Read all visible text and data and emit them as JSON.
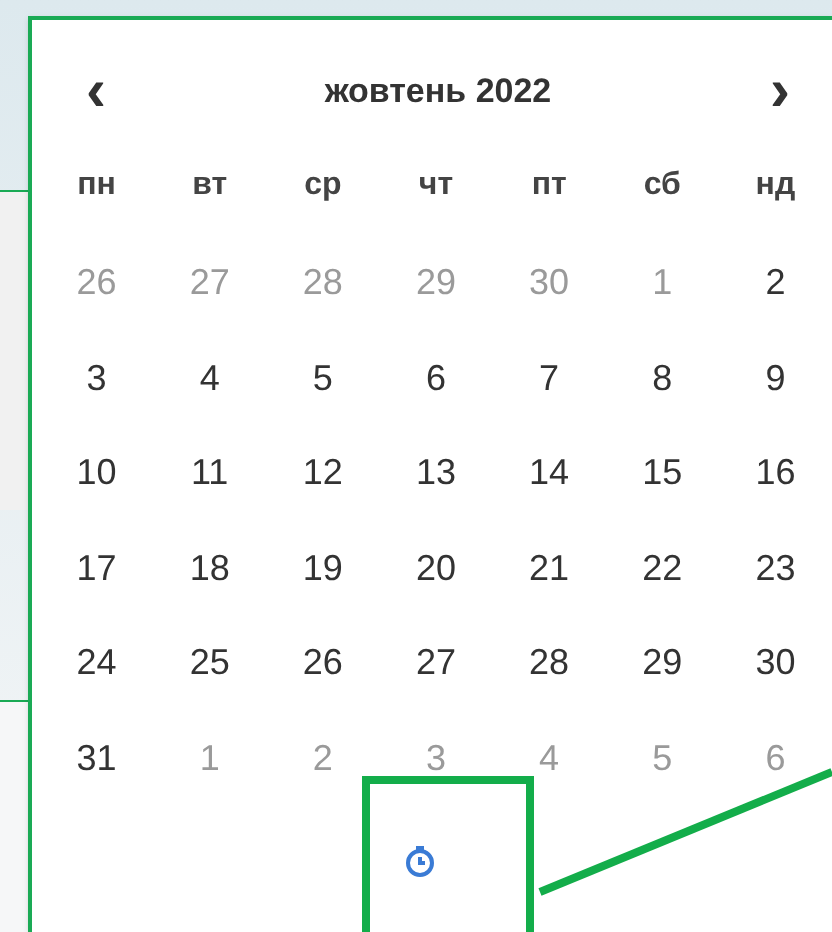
{
  "calendar": {
    "month_label": "жовтень 2022",
    "prev": "‹",
    "next": "›",
    "weekdays": [
      "пн",
      "вт",
      "ср",
      "чт",
      "пт",
      "сб",
      "нд"
    ],
    "weeks": [
      [
        {
          "day": "26",
          "dimmed": true
        },
        {
          "day": "27",
          "dimmed": true
        },
        {
          "day": "28",
          "dimmed": true
        },
        {
          "day": "29",
          "dimmed": true
        },
        {
          "day": "30",
          "dimmed": true
        },
        {
          "day": "1",
          "dimmed": true
        },
        {
          "day": "2",
          "dimmed": false
        }
      ],
      [
        {
          "day": "3",
          "dimmed": false
        },
        {
          "day": "4",
          "dimmed": false
        },
        {
          "day": "5",
          "dimmed": false
        },
        {
          "day": "6",
          "dimmed": false
        },
        {
          "day": "7",
          "dimmed": false
        },
        {
          "day": "8",
          "dimmed": false
        },
        {
          "day": "9",
          "dimmed": false
        }
      ],
      [
        {
          "day": "10",
          "dimmed": false
        },
        {
          "day": "11",
          "dimmed": false
        },
        {
          "day": "12",
          "dimmed": false
        },
        {
          "day": "13",
          "dimmed": false
        },
        {
          "day": "14",
          "dimmed": false
        },
        {
          "day": "15",
          "dimmed": false
        },
        {
          "day": "16",
          "dimmed": false
        }
      ],
      [
        {
          "day": "17",
          "dimmed": false
        },
        {
          "day": "18",
          "dimmed": false
        },
        {
          "day": "19",
          "dimmed": false
        },
        {
          "day": "20",
          "dimmed": false
        },
        {
          "day": "21",
          "dimmed": false
        },
        {
          "day": "22",
          "dimmed": false
        },
        {
          "day": "23",
          "dimmed": false
        }
      ],
      [
        {
          "day": "24",
          "dimmed": false
        },
        {
          "day": "25",
          "dimmed": false
        },
        {
          "day": "26",
          "dimmed": false
        },
        {
          "day": "27",
          "dimmed": false
        },
        {
          "day": "28",
          "dimmed": false
        },
        {
          "day": "29",
          "dimmed": false
        },
        {
          "day": "30",
          "dimmed": false
        }
      ],
      [
        {
          "day": "31",
          "dimmed": false
        },
        {
          "day": "1",
          "dimmed": true
        },
        {
          "day": "2",
          "dimmed": true
        },
        {
          "day": "3",
          "dimmed": true
        },
        {
          "day": "4",
          "dimmed": true
        },
        {
          "day": "5",
          "dimmed": true
        },
        {
          "day": "6",
          "dimmed": true
        }
      ]
    ]
  }
}
